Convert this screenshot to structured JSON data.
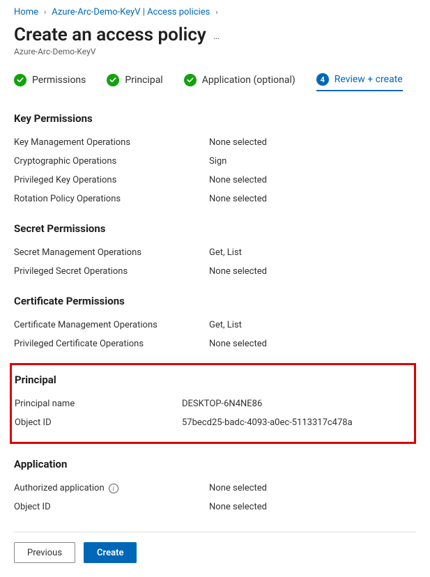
{
  "breadcrumb": {
    "home": "Home",
    "resource": "Azure-Arc-Demo-KeyV | Access policies"
  },
  "title": "Create an access policy",
  "subtitle": "Azure-Arc-Demo-KeyV",
  "steps": {
    "s1": "Permissions",
    "s2": "Principal",
    "s3": "Application (optional)",
    "s4_num": "4",
    "s4": "Review + create"
  },
  "sections": {
    "key_permissions": {
      "heading": "Key Permissions",
      "rows": {
        "kmo_label": "Key Management Operations",
        "kmo_value": "None selected",
        "crypto_label": "Cryptographic Operations",
        "crypto_value": "Sign",
        "priv_label": "Privileged Key Operations",
        "priv_value": "None selected",
        "rot_label": "Rotation Policy Operations",
        "rot_value": "None selected"
      }
    },
    "secret_permissions": {
      "heading": "Secret Permissions",
      "rows": {
        "smo_label": "Secret Management Operations",
        "smo_value": "Get, List",
        "priv_label": "Privileged Secret Operations",
        "priv_value": "None selected"
      }
    },
    "cert_permissions": {
      "heading": "Certificate Permissions",
      "rows": {
        "cmo_label": "Certificate Management Operations",
        "cmo_value": "Get, List",
        "priv_label": "Privileged Certificate Operations",
        "priv_value": "None selected"
      }
    },
    "principal": {
      "heading": "Principal",
      "rows": {
        "name_label": "Principal name",
        "name_value": "DESKTOP-6N4NE86",
        "oid_label": "Object ID",
        "oid_value": "57becd25-badc-4093-a0ec-5113317c478a"
      }
    },
    "application": {
      "heading": "Application",
      "rows": {
        "auth_label": "Authorized application",
        "auth_value": "None selected",
        "oid_label": "Object ID",
        "oid_value": "None selected"
      }
    }
  },
  "footer": {
    "previous": "Previous",
    "create": "Create"
  }
}
